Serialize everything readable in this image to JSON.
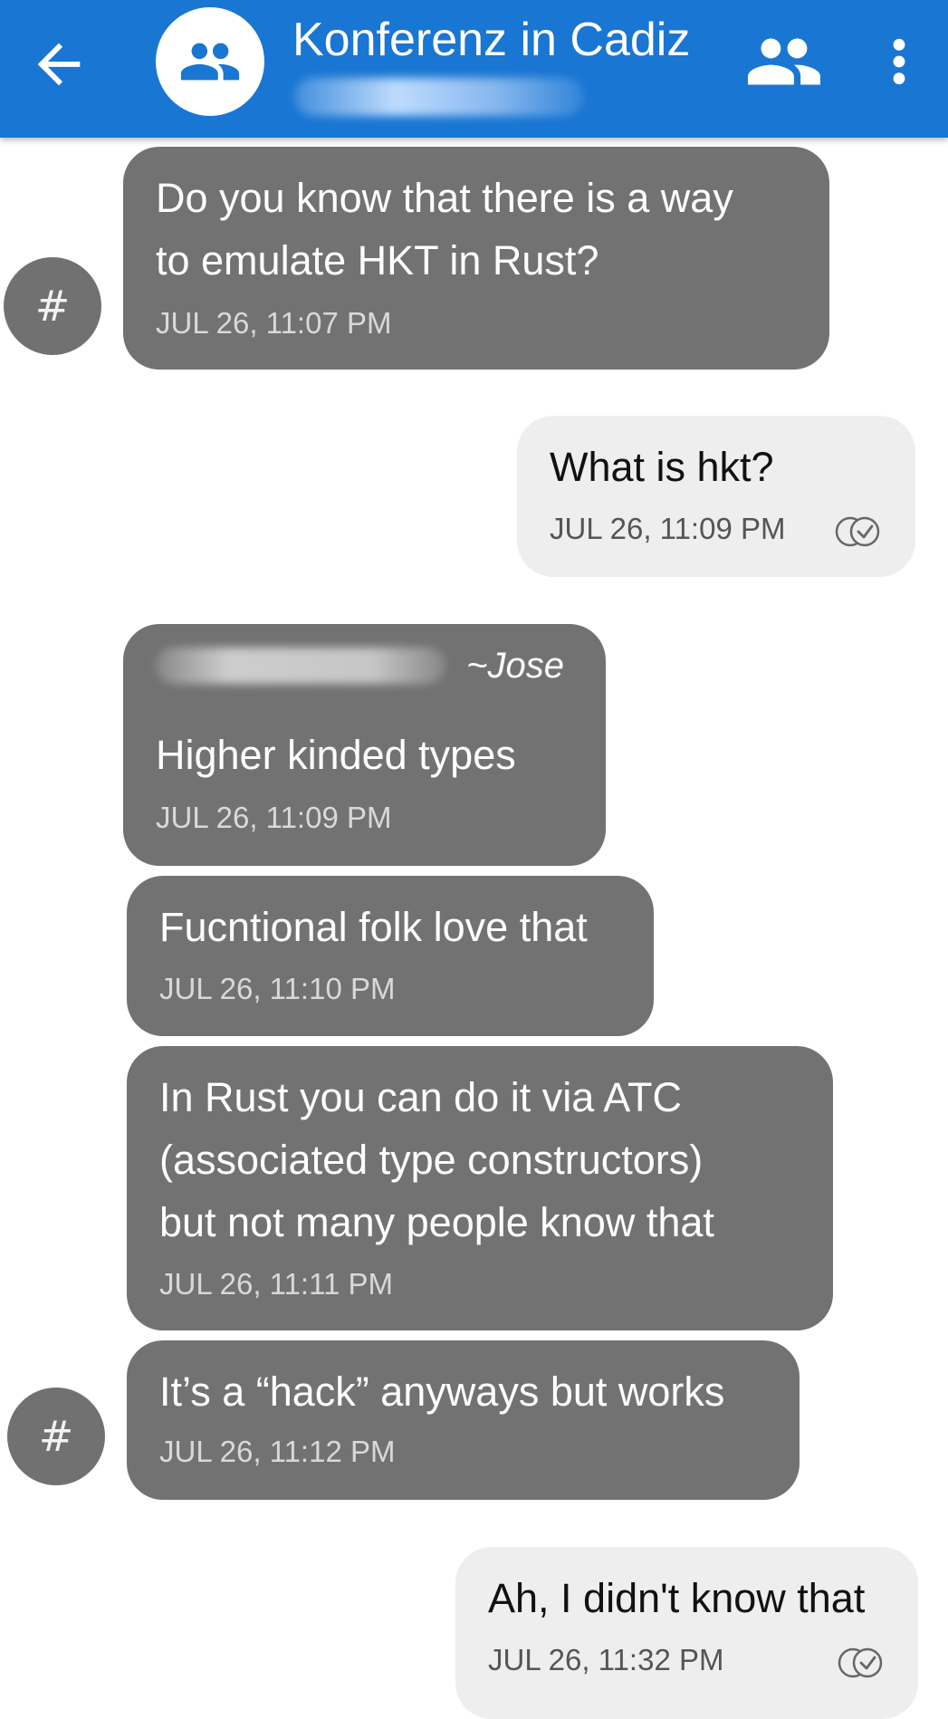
{
  "header": {
    "title": "Konferenz in Cadiz",
    "subtitle": ""
  },
  "colors": {
    "appbar": "#1976d2",
    "incoming_bubble": "#727272",
    "outgoing_bubble": "#eeeeee"
  },
  "icons": {
    "back": "arrow-back-icon",
    "group": "group-icon",
    "members": "people-icon",
    "more": "more-vert-icon",
    "read": "double-check-icon"
  },
  "messages": [
    {
      "direction": "incoming",
      "text": "Do you know that there is a way\nto emulate HKT in Rust?",
      "time": "JUL 26, 11:07 PM",
      "avatar": "#"
    },
    {
      "direction": "outgoing",
      "text": "What is hkt?",
      "time": "JUL 26, 11:09 PM"
    },
    {
      "direction": "incoming",
      "sender": "~Jose",
      "text": "Higher kinded types",
      "time": "JUL 26, 11:09 PM"
    },
    {
      "direction": "incoming",
      "text": "Fucntional folk love that",
      "time": "JUL 26, 11:10 PM"
    },
    {
      "direction": "incoming",
      "text": "In Rust you can do it via ATC\n(associated type constructors)\nbut not many people know that",
      "time": "JUL 26, 11:11 PM"
    },
    {
      "direction": "incoming",
      "text": "It’s a “hack” anyways but works",
      "time": "JUL 26, 11:12 PM",
      "avatar": "#"
    },
    {
      "direction": "outgoing",
      "text": "Ah, I didn't know that",
      "time": "JUL 26, 11:32 PM"
    }
  ]
}
